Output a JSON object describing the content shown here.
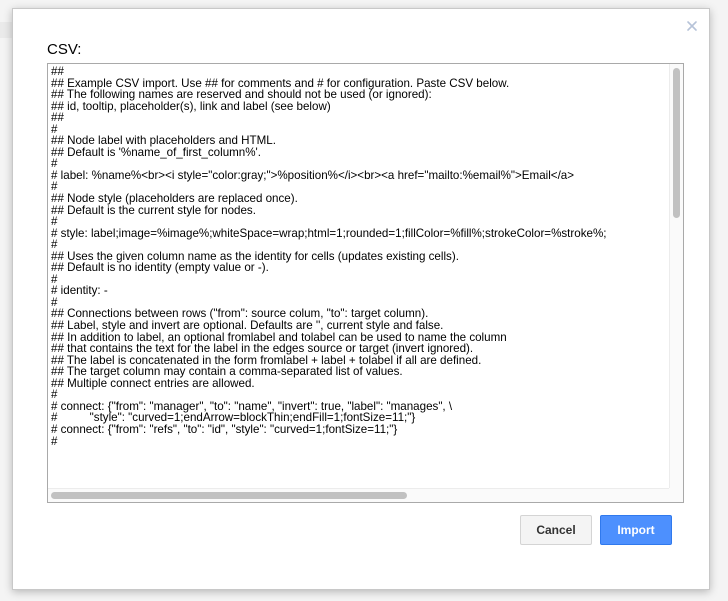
{
  "dialog": {
    "title": "CSV:",
    "close_glyph": "×",
    "close_icon": "close-icon",
    "csv_text": "##\n## Example CSV import. Use ## for comments and # for configuration. Paste CSV below.\n## The following names are reserved and should not be used (or ignored):\n## id, tooltip, placeholder(s), link and label (see below)\n##\n#\n## Node label with placeholders and HTML.\n## Default is '%name_of_first_column%'.\n#\n# label: %name%<br><i style=\"color:gray;\">%position%</i><br><a href=\"mailto:%email%\">Email</a>\n#\n## Node style (placeholders are replaced once).\n## Default is the current style for nodes.\n#\n# style: label;image=%image%;whiteSpace=wrap;html=1;rounded=1;fillColor=%fill%;strokeColor=%stroke%;\n#\n## Uses the given column name as the identity for cells (updates existing cells).\n## Default is no identity (empty value or -).\n#\n# identity: -\n#\n## Connections between rows (\"from\": source colum, \"to\": target column).\n## Label, style and invert are optional. Defaults are '', current style and false.\n## In addition to label, an optional fromlabel and tolabel can be used to name the column\n## that contains the text for the label in the edges source or target (invert ignored).\n## The label is concatenated in the form fromlabel + label + tolabel if all are defined.\n## The target column may contain a comma-separated list of values.\n## Multiple connect entries are allowed.\n#\n# connect: {\"from\": \"manager\", \"to\": \"name\", \"invert\": true, \"label\": \"manages\", \\\n#          \"style\": \"curved=1;endArrow=blockThin;endFill=1;fontSize=11;\"}\n# connect: {\"from\": \"refs\", \"to\": \"id\", \"style\": \"curved=1;fontSize=11;\"}\n#",
    "buttons": {
      "cancel_label": "Cancel",
      "import_label": "Import"
    },
    "colors": {
      "import_bg": "#4d90fe",
      "cancel_bg": "#f4f4f4",
      "close_icon": "#b6c3d8"
    }
  }
}
